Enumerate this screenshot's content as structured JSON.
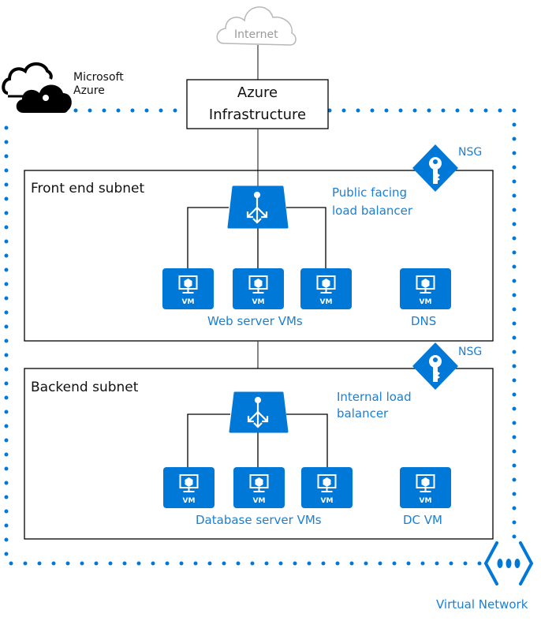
{
  "internet": {
    "label": "Internet"
  },
  "azure_logo": {
    "line1": "Microsoft",
    "line2": "Azure"
  },
  "azure_infrastructure": {
    "line1": "Azure",
    "line2": "Infrastructure"
  },
  "frontend_subnet": {
    "title": "Front end subnet",
    "nsg_label": "NSG",
    "load_balancer": {
      "line1": "Public facing",
      "line2": "load balancer"
    },
    "vm_group_label": "Web server VMs",
    "vms": [
      {
        "badge": "VM"
      },
      {
        "badge": "VM"
      },
      {
        "badge": "VM"
      }
    ],
    "extra_vm": {
      "badge": "VM",
      "label": "DNS"
    }
  },
  "backend_subnet": {
    "title": "Backend subnet",
    "nsg_label": "NSG",
    "load_balancer": {
      "line1": "Internal load",
      "line2": "balancer"
    },
    "vm_group_label": "Database server VMs",
    "vms": [
      {
        "badge": "VM"
      },
      {
        "badge": "VM"
      },
      {
        "badge": "VM"
      }
    ],
    "extra_vm": {
      "badge": "VM",
      "label": "DC VM"
    }
  },
  "virtual_network": {
    "label": "Virtual Network"
  },
  "colors": {
    "accent": "#0078d7",
    "accent_text": "#1a7fd4",
    "line": "#000000",
    "internet_gray": "#b8b8b8"
  }
}
